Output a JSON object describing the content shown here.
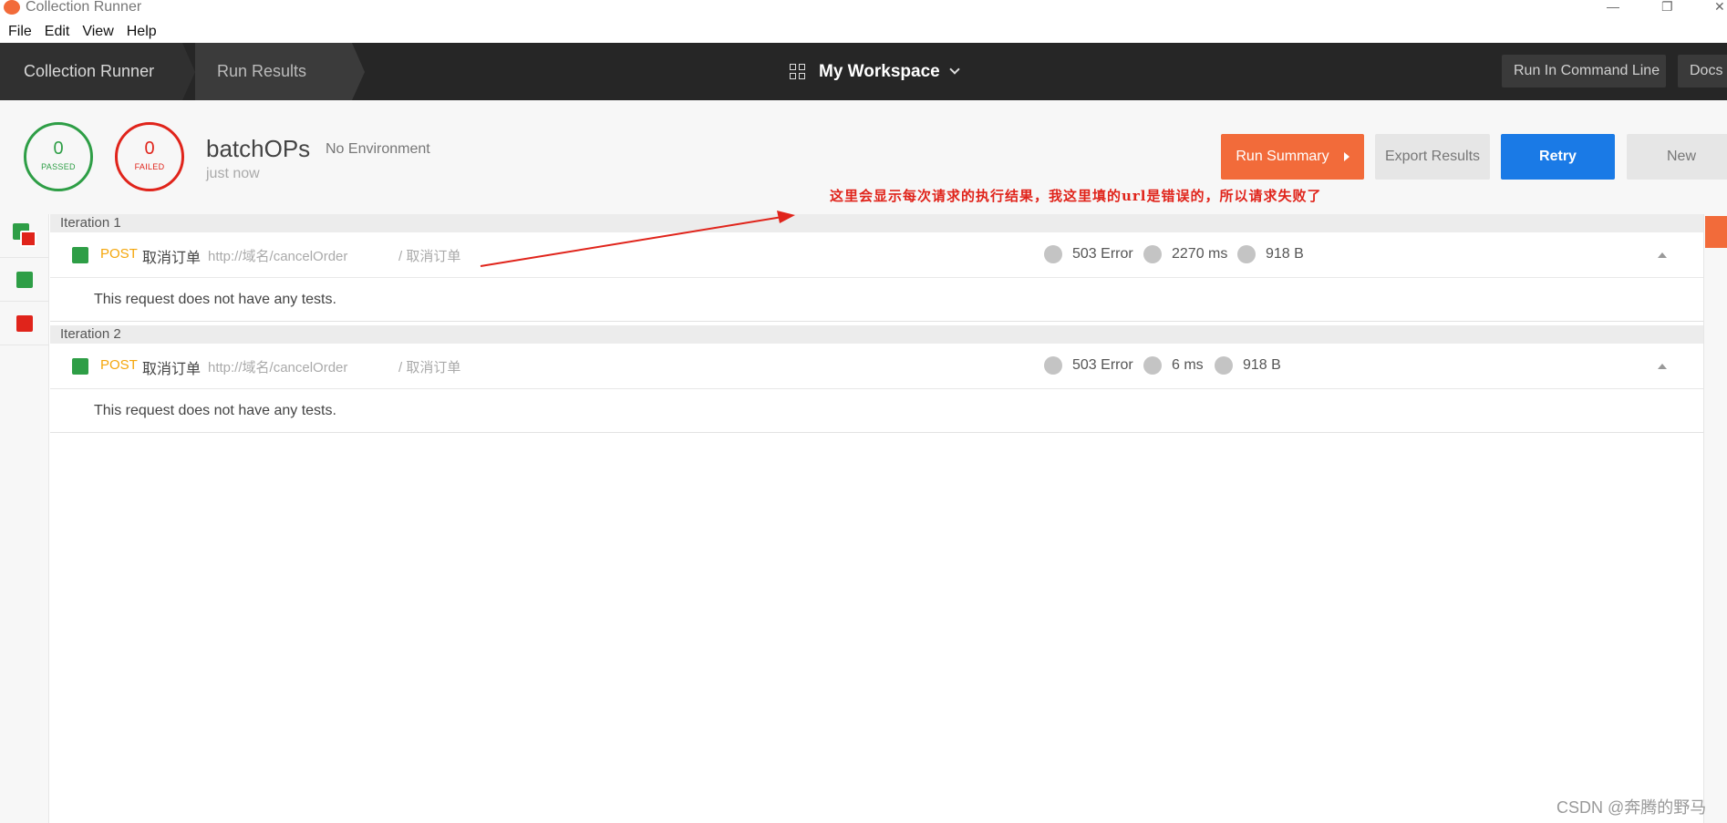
{
  "window": {
    "title": "Collection Runner",
    "controls": [
      "—",
      "❐",
      "✕"
    ]
  },
  "menu": [
    "File",
    "Edit",
    "View",
    "Help"
  ],
  "header": {
    "breadcrumb": [
      "Collection Runner",
      "Run Results"
    ],
    "workspace": "My Workspace",
    "run_cli": "Run In Command Line",
    "docs": "Docs"
  },
  "summary": {
    "passed_count": "0",
    "passed_label": "PASSED",
    "failed_count": "0",
    "failed_label": "FAILED",
    "collection": "batchOPs",
    "environment": "No Environment",
    "time": "just now",
    "buttons": {
      "run_summary": "Run Summary",
      "export": "Export Results",
      "retry": "Retry",
      "new": "New"
    }
  },
  "annotation": "这里会显示每次请求的执行结果，我这里填的url是错误的，所以请求失败了",
  "iterations": [
    {
      "label": "Iteration 1",
      "method": "POST",
      "name": "取消订单",
      "url": "http://域名/cancelOrder",
      "path": "/ 取消订单",
      "status": "503 Error",
      "time": "2270 ms",
      "size": "918 B",
      "tests": "This request does not have any tests."
    },
    {
      "label": "Iteration 2",
      "method": "POST",
      "name": "取消订单",
      "url": "http://域名/cancelOrder",
      "path": "/ 取消订单",
      "status": "503 Error",
      "time": "6 ms",
      "size": "918 B",
      "tests": "This request does not have any tests."
    }
  ],
  "colors": {
    "accent": "#f26b3a",
    "pass": "#2e9e46",
    "fail": "#e0241b",
    "primary": "#1a7ae6",
    "method": "#f4a60b"
  },
  "watermark": "CSDN @奔腾的野马"
}
